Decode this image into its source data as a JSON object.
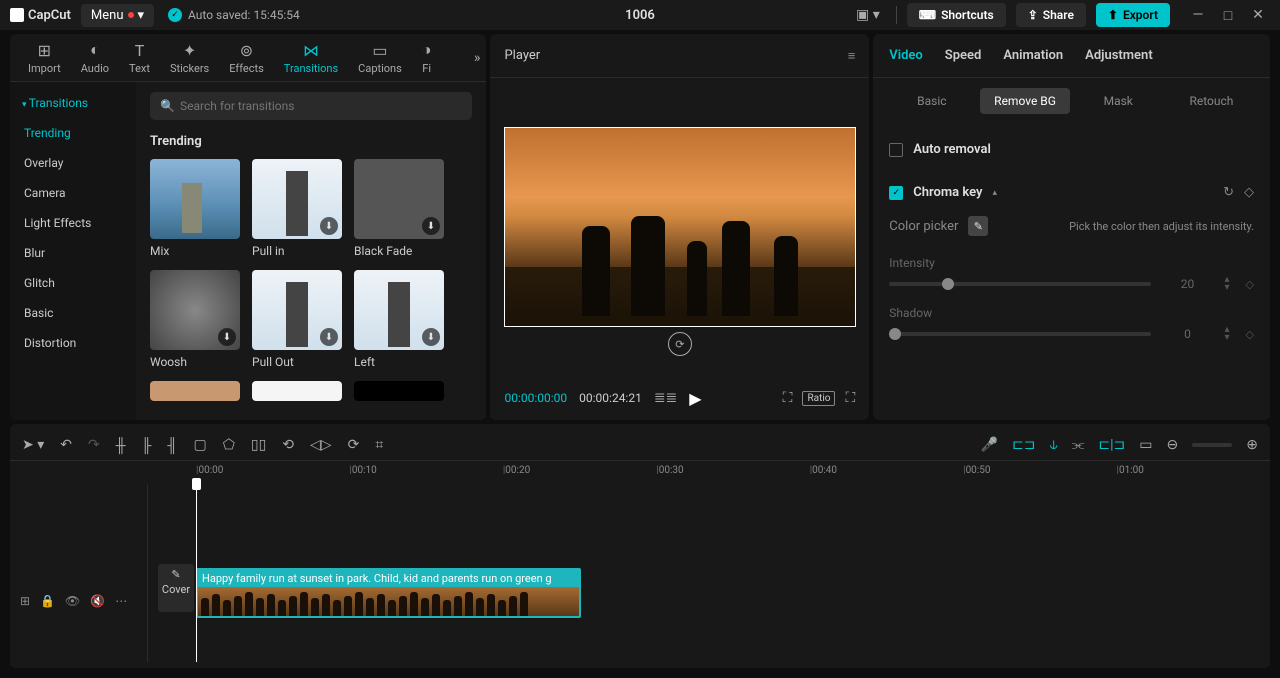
{
  "titlebar": {
    "brand": "CapCut",
    "menu_label": "Menu",
    "autosave": "Auto saved: 15:45:54",
    "project_name": "1006",
    "shortcuts_label": "Shortcuts",
    "share_label": "Share",
    "export_label": "Export"
  },
  "media_tabs": [
    {
      "label": "Import",
      "icon": "import-icon"
    },
    {
      "label": "Audio",
      "icon": "audio-icon"
    },
    {
      "label": "Text",
      "icon": "text-icon"
    },
    {
      "label": "Stickers",
      "icon": "stickers-icon"
    },
    {
      "label": "Effects",
      "icon": "effects-icon"
    },
    {
      "label": "Transitions",
      "icon": "transitions-icon"
    },
    {
      "label": "Captions",
      "icon": "captions-icon"
    },
    {
      "label": "Fi",
      "icon": "filters-icon"
    }
  ],
  "categories": {
    "header": "Transitions",
    "items": [
      "Trending",
      "Overlay",
      "Camera",
      "Light Effects",
      "Blur",
      "Glitch",
      "Basic",
      "Distortion"
    ]
  },
  "search": {
    "placeholder": "Search for transitions"
  },
  "browser": {
    "section_title": "Trending",
    "items": [
      "Mix",
      "Pull in",
      "Black Fade",
      "Woosh",
      "Pull Out",
      "Left"
    ]
  },
  "player": {
    "title": "Player",
    "time_current": "00:00:00:00",
    "time_total": "00:00:24:21",
    "ratio_label": "Ratio"
  },
  "inspector": {
    "tabs": [
      "Video",
      "Speed",
      "Animation",
      "Adjustment"
    ],
    "subtabs": [
      "Basic",
      "Remove BG",
      "Mask",
      "Retouch"
    ],
    "auto_removal_label": "Auto removal",
    "chroma_key_label": "Chroma key",
    "color_picker_label": "Color picker",
    "help_text": "Pick the color then adjust its intensity.",
    "intensity_label": "Intensity",
    "intensity_value": "20",
    "shadow_label": "Shadow",
    "shadow_value": "0"
  },
  "timeline": {
    "ruler": [
      "00:00",
      "00:10",
      "00:20",
      "00:30",
      "00:40",
      "00:50",
      "01:00"
    ],
    "cover_label": "Cover",
    "clip_title": "Happy family run at sunset in park. Child, kid and parents run on green g"
  }
}
